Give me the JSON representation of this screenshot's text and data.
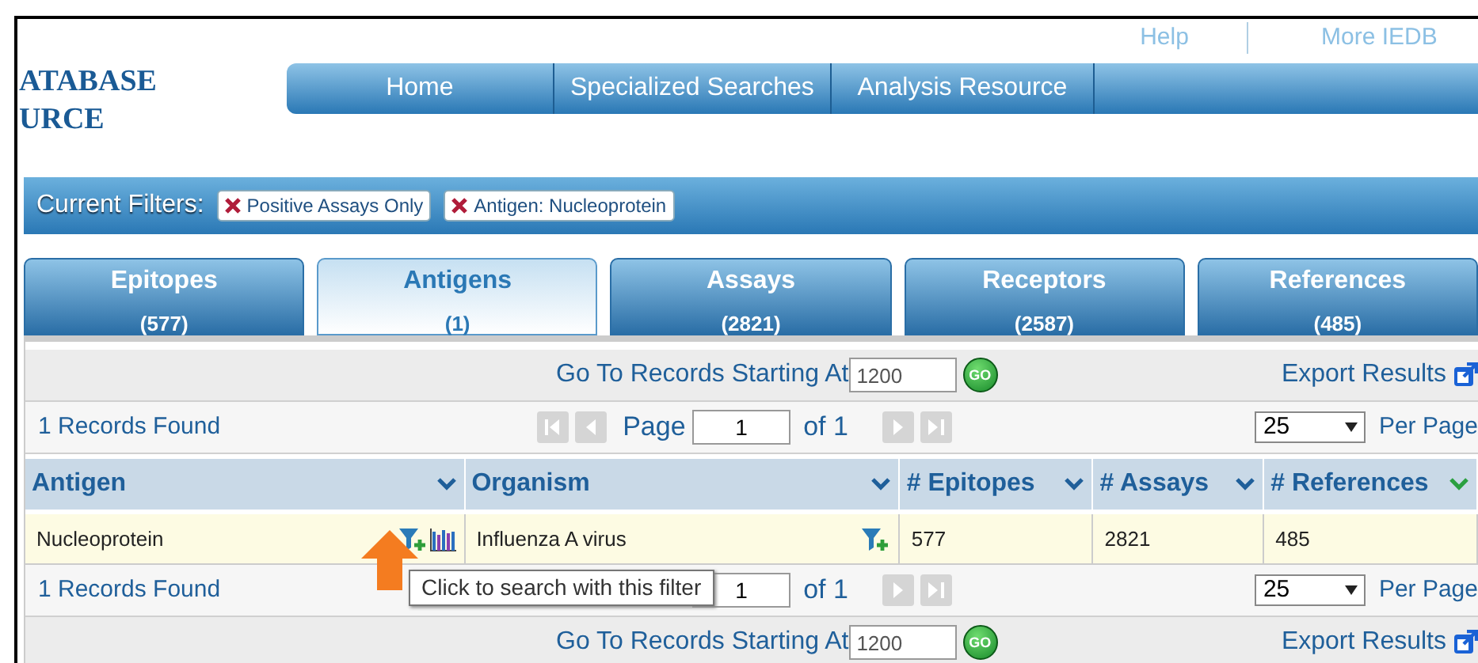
{
  "header_links": [
    "Help",
    "More IEDB"
  ],
  "logo": {
    "lines": [
      "ATABASE",
      "URCE"
    ]
  },
  "nav": [
    "Home",
    "Specialized Searches",
    "Analysis Resource"
  ],
  "filters": {
    "label": "Current Filters:",
    "items": [
      "Positive Assays Only",
      "Antigen: Nucleoprotein"
    ]
  },
  "tabs": [
    {
      "label": "Epitopes",
      "count": "(577)",
      "selected": false
    },
    {
      "label": "Antigens",
      "count": "(1)",
      "selected": true
    },
    {
      "label": "Assays",
      "count": "(2821)",
      "selected": false
    },
    {
      "label": "Receptors",
      "count": "(2587)",
      "selected": false
    },
    {
      "label": "References",
      "count": "(485)",
      "selected": false
    }
  ],
  "top_controls": {
    "goto_label": "Go To Records Starting At",
    "goto_value": "1200",
    "go_button": "GO",
    "export": "Export Results",
    "records_found": "1 Records Found",
    "page_label": "Page",
    "page_value": "1",
    "page_of": "of 1",
    "per_page_value": "25",
    "per_page_label": "Per Page"
  },
  "table": {
    "columns": [
      {
        "label": "Antigen",
        "sorted": false
      },
      {
        "label": "Organism",
        "sorted": false
      },
      {
        "label": "# Epitopes",
        "sorted": false
      },
      {
        "label": "# Assays",
        "sorted": false
      },
      {
        "label": "# References",
        "sorted": true
      }
    ],
    "rows": [
      {
        "cells": [
          {
            "text": "Nucleoprotein",
            "kind": "filter_chart"
          },
          {
            "text": "Influenza A virus",
            "kind": "filter"
          },
          {
            "text": "577",
            "kind": "plain"
          },
          {
            "text": "2821",
            "kind": "plain"
          },
          {
            "text": "485",
            "kind": "plain"
          }
        ]
      }
    ]
  },
  "bottom_controls": {
    "records_found": "1 Records Found",
    "page_value": "1",
    "page_of": "of 1",
    "per_page_value": "25",
    "per_page_label": "Per Page",
    "goto_label": "Go To Records Starting At",
    "goto_value": "1200",
    "go_button": "GO",
    "export": "Export Results"
  },
  "tooltip": "Click to search with this filter"
}
